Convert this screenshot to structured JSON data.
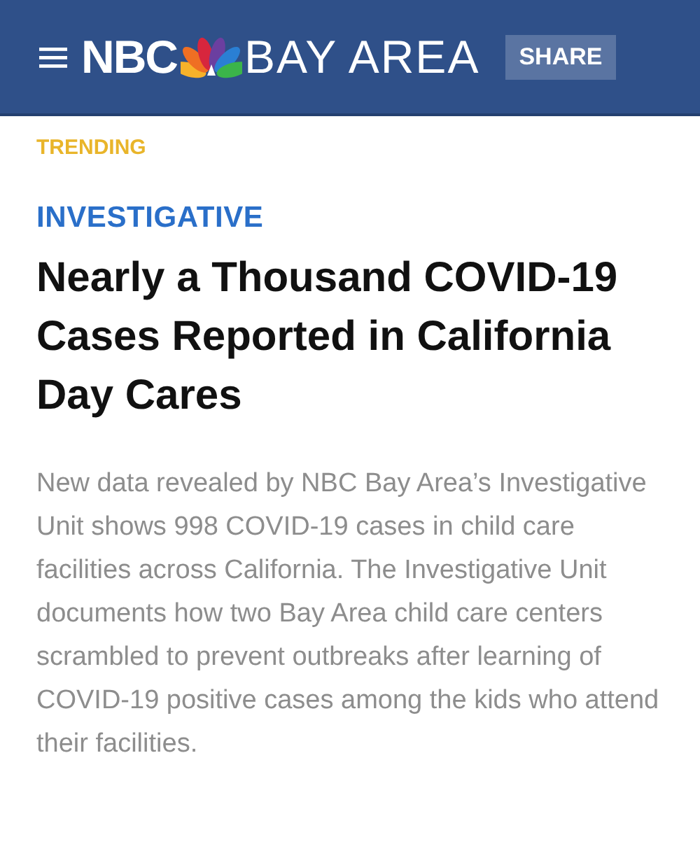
{
  "header": {
    "logo_left": "NBC",
    "logo_right": "BAY AREA",
    "share_button": "SHARE"
  },
  "trending_label": "TRENDING",
  "article": {
    "category": "INVESTIGATIVE",
    "headline": "Nearly a Thousand COVID-19 Cases Reported in California Day Cares",
    "summary": "New data revealed by NBC Bay Area’s Investigative Unit shows 998 COVID-19 cases in child care facilities across California.  The Investigative Unit documents how two Bay Area child care centers scrambled to prevent outbreaks after learning of COVID-19 positive cases among the kids who attend their facilities."
  }
}
